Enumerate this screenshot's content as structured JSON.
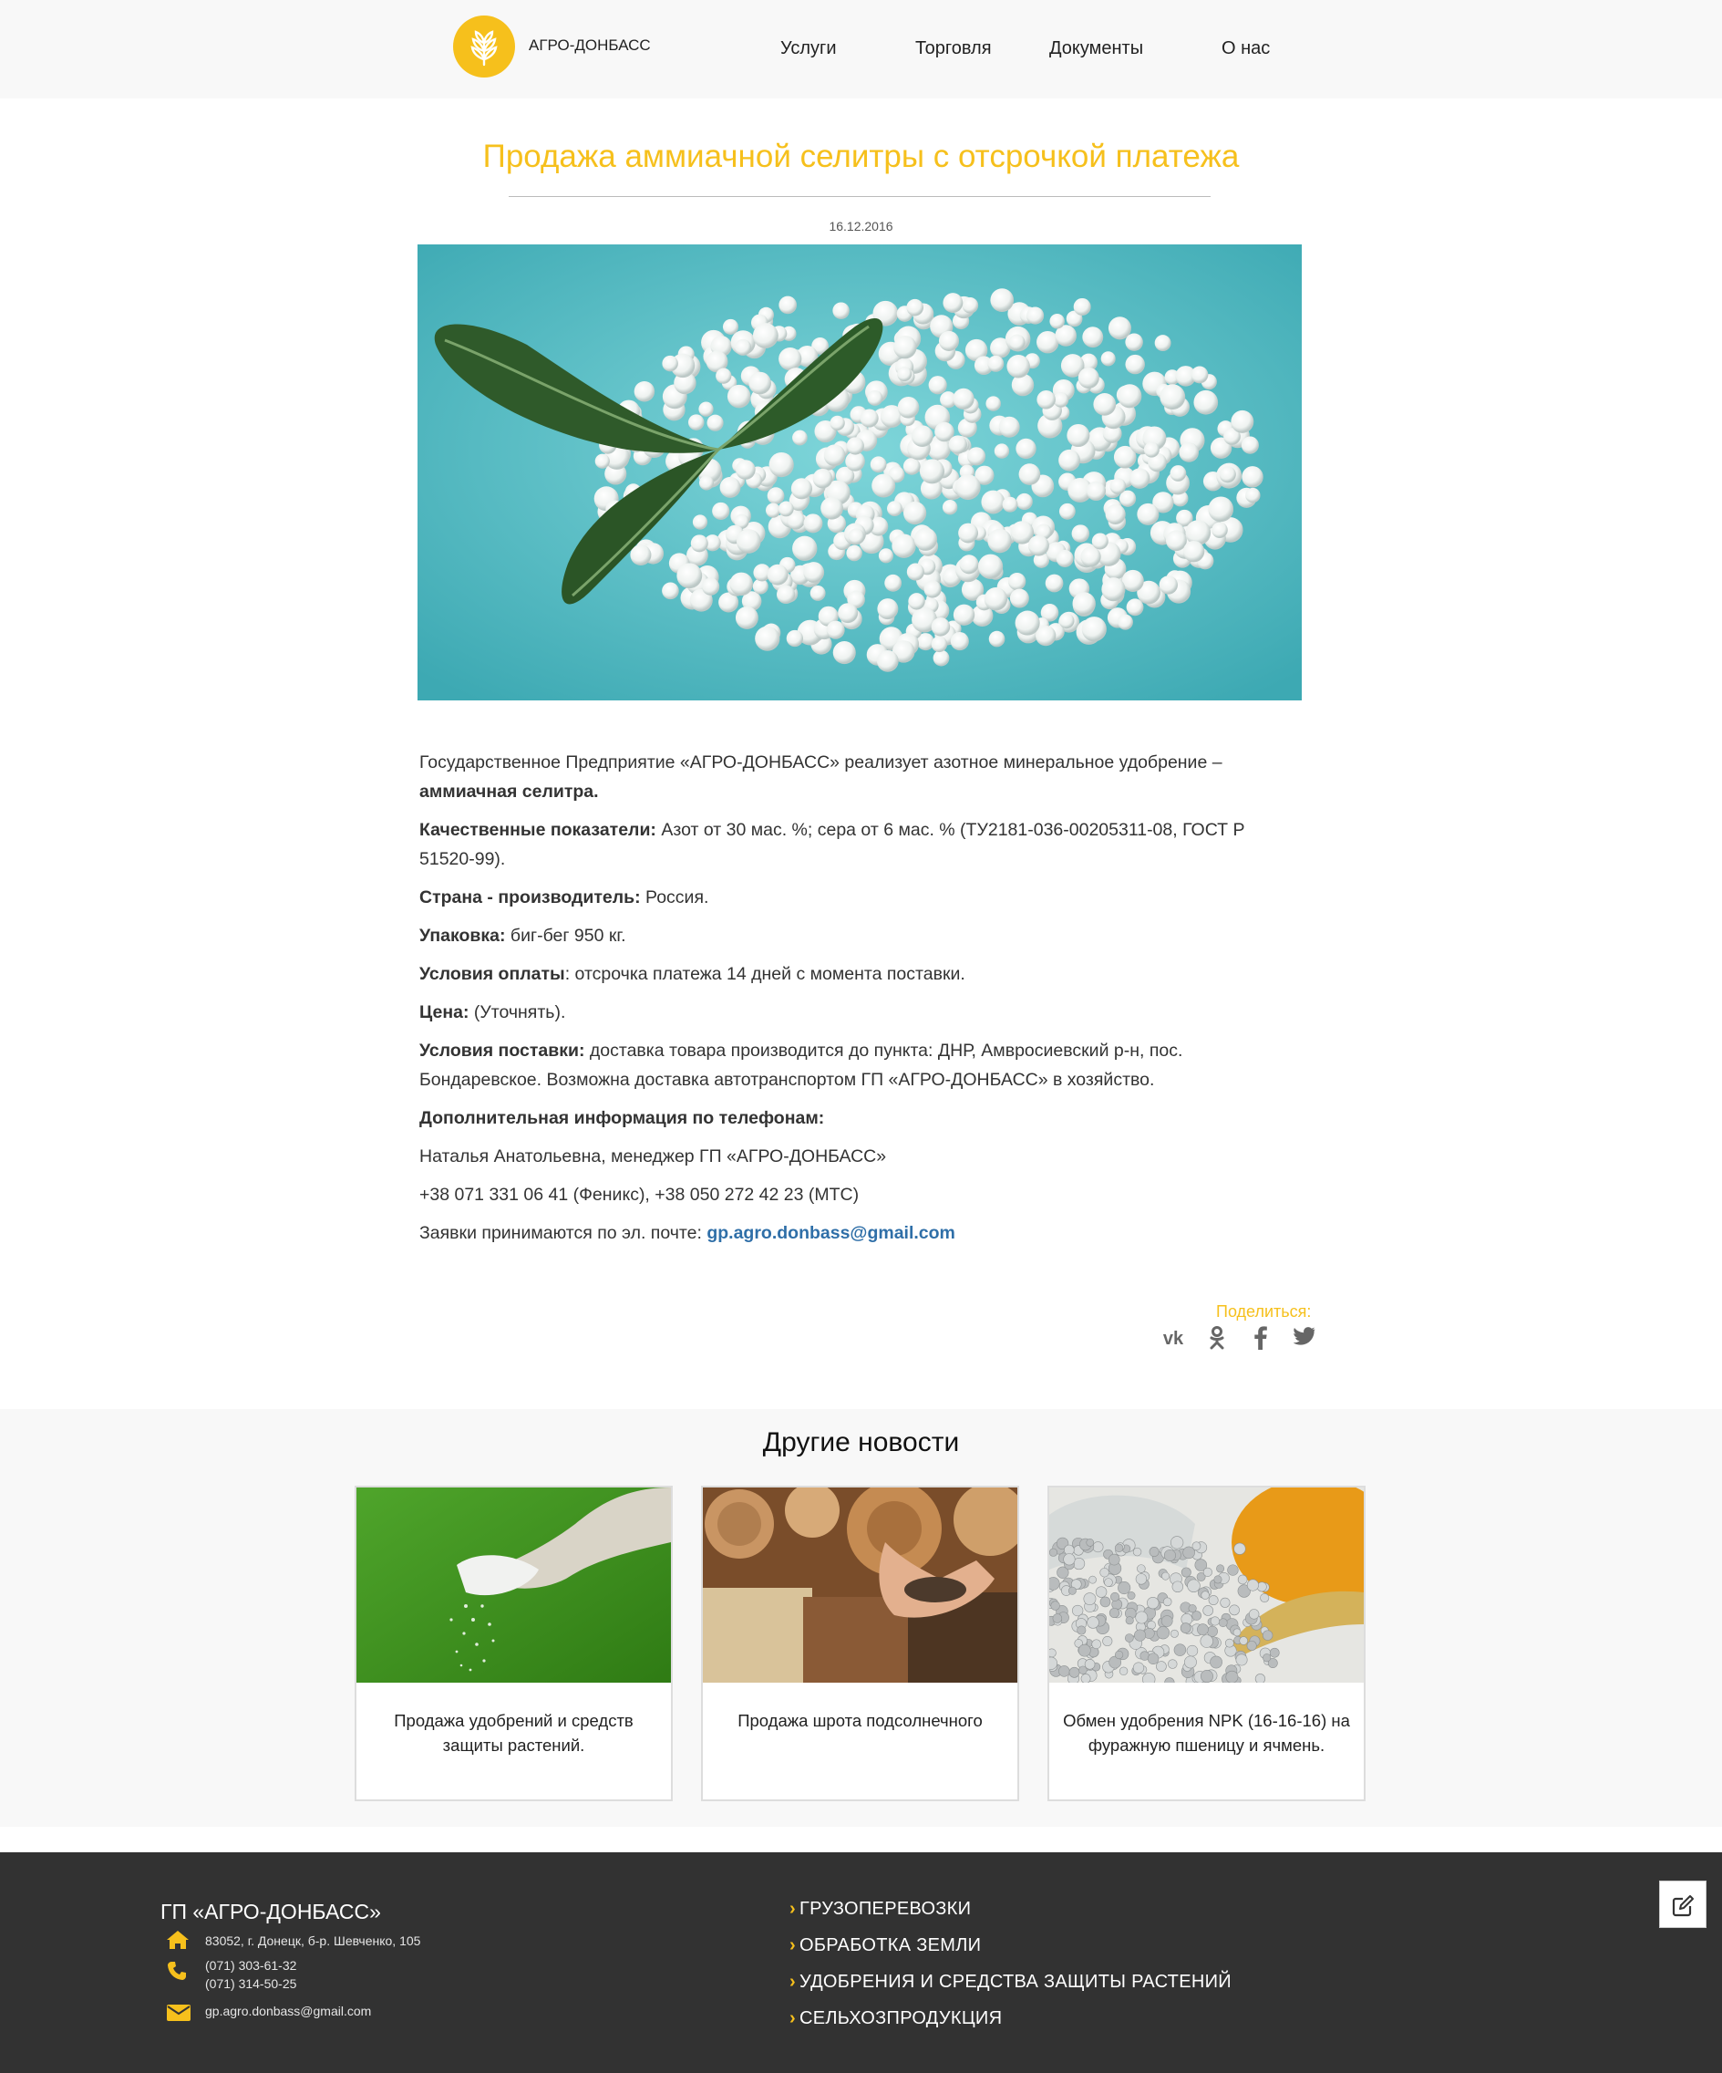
{
  "header": {
    "brand": "АГРО-ДОНБАСС",
    "nav": [
      "Услуги",
      "Торговля",
      "Документы",
      "О нас"
    ]
  },
  "article": {
    "title": "Продажа аммиачной селитры с отсрочкой платежа",
    "date": "16.12.2016",
    "intro": "Государственное Предприятие «АГРО-ДОНБАСС» реализует азотное минеральное удобрение –",
    "intro_bold": "аммиачная селитра.",
    "quality_label": "Качественные показатели:",
    "quality_value": " Азот от 30 мас. %; сера от 6 мас. % (ТУ2181-036-00205311-08, ГОСТ Р 51520-99).",
    "country_label": "Страна - производитель:",
    "country_value": " Россия.",
    "package_label": "Упаковка:",
    "package_value": " биг-бег 950 кг.",
    "payment_label": "Условия оплаты",
    "payment_value": ": отсрочка платежа 14 дней с момента поставки.",
    "price_label": "Цена:",
    "price_value": " (Уточнять).",
    "delivery_label": "Условия поставки:",
    "delivery_value": " доставка товара производится до пункта: ДНР, Амвросиевский р-н, пос. Бондаревское. Возможна доставка автотранспортом ГП «АГРО-ДОНБАСС» в хозяйство.",
    "info_label": "Дополнительная информация по телефонам:",
    "manager": "Наталья Анатольевна, менеджер ГП «АГРО-ДОНБАСС»",
    "phones": "+38 071 331 06 41 (Феникс), +38 050 272 42 23 (МТС)",
    "email_prefix": "Заявки принимаются по эл. почте: ",
    "email": "gp.agro.donbass@gmail.com"
  },
  "share": {
    "label": "Поделиться:",
    "icons": [
      "vk-icon",
      "odnoklassniki-icon",
      "facebook-icon",
      "twitter-icon"
    ]
  },
  "news": {
    "heading": "Другие новости",
    "items": [
      {
        "title": "Продажа удобрений и средств защиты растений."
      },
      {
        "title": "Продажа шрота подсолнечного"
      },
      {
        "title": "Обмен удобрения NPK (16-16-16) на фуражную пшеницу и ячмень."
      }
    ]
  },
  "footer": {
    "company": "ГП «АГРО-ДОНБАСС»",
    "address": "83052, г. Донецк, б-р. Шевченко, 105",
    "phone1": "(071) 303-61-32",
    "phone2": "(071) 314-50-25",
    "email": "gp.agro.donbass@gmail.com",
    "links": [
      "ГРУЗОПЕРЕВОЗКИ",
      "ОБРАБОТКА ЗЕМЛИ",
      "УДОБРЕНИЯ И СРЕДСТВА ЗАЩИТЫ РАСТЕНИЙ",
      "СЕЛЬХОЗПРОДУКЦИЯ"
    ]
  },
  "colors": {
    "accent": "#f6c01c",
    "link": "#2f6fa8",
    "footer_bg": "#323232"
  }
}
